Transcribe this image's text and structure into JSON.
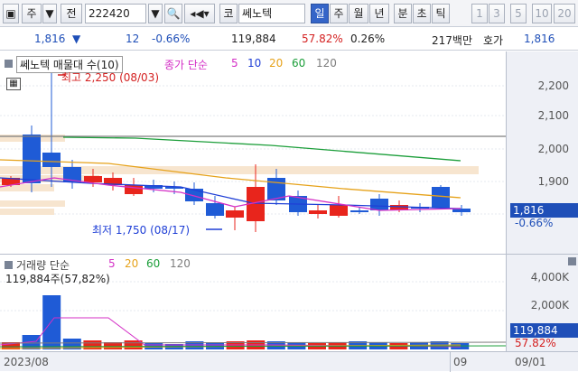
{
  "toolbar": {
    "menu_button": "주",
    "code_label": "전",
    "stock_code": "222420",
    "market_prefix": "코",
    "stock_name": "쎄노텍",
    "periods": [
      "일",
      "주",
      "월",
      "년",
      "분",
      "초",
      "틱"
    ],
    "selected_period": "일",
    "intervals": [
      "1",
      "3",
      "5",
      "10",
      "20"
    ]
  },
  "info": {
    "price": "1,816",
    "change_arrow": "▼",
    "change": "12",
    "change_pct": "-0.66%",
    "volume": "119,884",
    "volume_ratio": "57.82%",
    "turnover": "0.26%",
    "trade_value": "217백만",
    "bid_label": "호가",
    "bid_price": "1,816"
  },
  "price_panel": {
    "legend_title": "쎄노텍 매물대 수(10)",
    "legend_ma_label": "종가 단순",
    "ma_periods": [
      "5",
      "10",
      "20",
      "60",
      "120"
    ],
    "high_annotation": "최고 2,250 (08/03)",
    "low_annotation": "최저 1,750 (08/17)",
    "axis_ticks": [
      "2,200",
      "2,100",
      "2,000",
      "1,900"
    ],
    "current_price_box": "1,816",
    "current_change_box": "-0.66%"
  },
  "volume_panel": {
    "legend_title": "거래량 단순",
    "ma_periods": [
      "5",
      "20",
      "60",
      "120"
    ],
    "value_label": "119,884주(57,82%)",
    "axis_ticks": [
      "4,000K",
      "2,000K"
    ],
    "current_volume_box": "119,884",
    "current_pct_box": "57.82%"
  },
  "time_axis": {
    "labels": [
      "2023/08",
      "09",
      "09/01"
    ]
  },
  "colors": {
    "up": "#e8251c",
    "down": "#1f5bd6",
    "ma5": "#d42fc6",
    "ma10": "#1f3fd6",
    "ma20": "#e6a21a",
    "ma60": "#1c9e3a",
    "ma120": "#7d7d7d",
    "volume_profile": "#f7e5cf"
  }
}
